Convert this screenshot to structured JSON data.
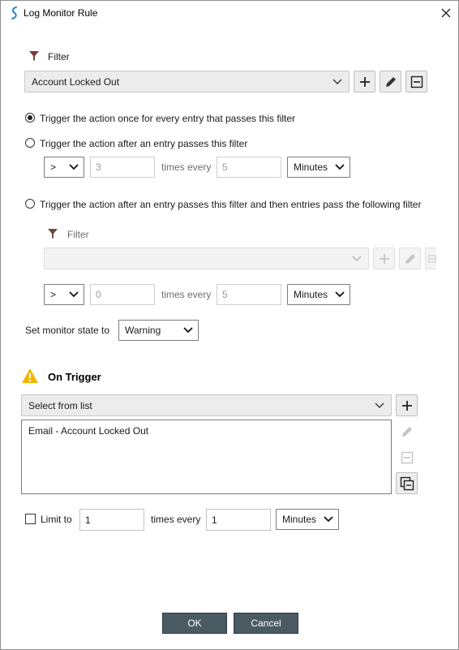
{
  "window": {
    "title": "Log Monitor Rule"
  },
  "filter_section": {
    "label": "Filter",
    "selected": "Account Locked Out"
  },
  "trigger_options": {
    "option1_label": "Trigger the action once for every entry that passes this filter",
    "option2_label": "Trigger the action after an entry passes this filter",
    "option2": {
      "operator": ">",
      "count": "3",
      "times_every_label": "times every",
      "interval": "5",
      "unit": "Minutes"
    },
    "option3_label": "Trigger the action after an entry passes this filter and then entries pass the following filter",
    "option3": {
      "filter_label": "Filter",
      "filter_selected": "",
      "operator": ">",
      "count": "0",
      "times_every_label": "times every",
      "interval": "5",
      "unit": "Minutes"
    },
    "selected_option": 1
  },
  "monitor_state": {
    "label": "Set monitor state to",
    "value": "Warning"
  },
  "on_trigger": {
    "title": "On Trigger",
    "select_placeholder": "Select from list",
    "actions": [
      "Email - Account Locked Out"
    ]
  },
  "limit": {
    "checkbox_label": "Limit to",
    "checked": false,
    "count": "1",
    "times_every_label": "times every",
    "interval": "1",
    "unit": "Minutes"
  },
  "buttons": {
    "ok": "OK",
    "cancel": "Cancel"
  },
  "colors": {
    "dialog_button": "#4a5a63",
    "warning_icon": "#f2b705",
    "filter_icon": "#7a3b2e"
  }
}
